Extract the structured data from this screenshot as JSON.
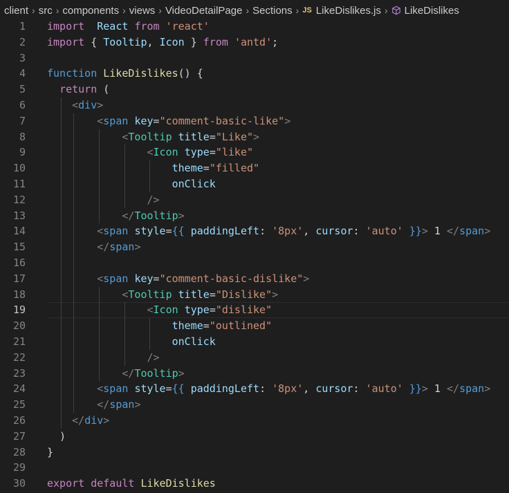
{
  "breadcrumb": {
    "items": [
      "client",
      "src",
      "components",
      "views",
      "VideoDetailPage",
      "Sections"
    ],
    "file_badge": "JS",
    "file": "LikeDislikes.js",
    "symbol": "LikeDislikes"
  },
  "editor": {
    "current_line": 19,
    "lines": [
      {
        "n": "1",
        "s": [
          [
            "kw",
            "import"
          ],
          [
            "",
            "  "
          ],
          [
            "var",
            "React"
          ],
          [
            "",
            " "
          ],
          [
            "kw",
            "from"
          ],
          [
            "",
            " "
          ],
          [
            "str",
            "'react'"
          ]
        ]
      },
      {
        "n": "2",
        "s": [
          [
            "kw",
            "import"
          ],
          [
            "",
            " { "
          ],
          [
            "var",
            "Tooltip"
          ],
          [
            "",
            ", "
          ],
          [
            "var",
            "Icon"
          ],
          [
            "",
            " } "
          ],
          [
            "kw",
            "from"
          ],
          [
            "",
            " "
          ],
          [
            "str",
            "'antd'"
          ],
          [
            "",
            ";"
          ]
        ]
      },
      {
        "n": "3",
        "s": []
      },
      {
        "n": "4",
        "s": [
          [
            "kwb",
            "function"
          ],
          [
            "",
            " "
          ],
          [
            "fn",
            "LikeDislikes"
          ],
          [
            "",
            "() {"
          ]
        ]
      },
      {
        "n": "5",
        "s": [
          [
            "",
            "  "
          ],
          [
            "kw",
            "return"
          ],
          [
            "",
            " ("
          ]
        ]
      },
      {
        "n": "6",
        "s": [
          [
            "",
            "    "
          ],
          [
            "br",
            "<"
          ],
          [
            "htag",
            "div"
          ],
          [
            "br",
            ">"
          ]
        ]
      },
      {
        "n": "7",
        "s": [
          [
            "",
            "        "
          ],
          [
            "br",
            "<"
          ],
          [
            "htag",
            "span"
          ],
          [
            "",
            " "
          ],
          [
            "attr",
            "key"
          ],
          [
            "",
            "="
          ],
          [
            "str",
            "\"comment-basic-like\""
          ],
          [
            "br",
            ">"
          ]
        ]
      },
      {
        "n": "8",
        "s": [
          [
            "",
            "            "
          ],
          [
            "br",
            "<"
          ],
          [
            "tag",
            "Tooltip"
          ],
          [
            "",
            " "
          ],
          [
            "attr",
            "title"
          ],
          [
            "",
            "="
          ],
          [
            "str",
            "\"Like\""
          ],
          [
            "br",
            ">"
          ]
        ]
      },
      {
        "n": "9",
        "s": [
          [
            "",
            "                "
          ],
          [
            "br",
            "<"
          ],
          [
            "tag",
            "Icon"
          ],
          [
            "",
            " "
          ],
          [
            "attr",
            "type"
          ],
          [
            "",
            "="
          ],
          [
            "str",
            "\"like\""
          ]
        ]
      },
      {
        "n": "10",
        "s": [
          [
            "",
            "                    "
          ],
          [
            "attr",
            "theme"
          ],
          [
            "",
            "="
          ],
          [
            "str",
            "\"filled\""
          ]
        ]
      },
      {
        "n": "11",
        "s": [
          [
            "",
            "                    "
          ],
          [
            "attr",
            "onClick"
          ]
        ]
      },
      {
        "n": "12",
        "s": [
          [
            "",
            "                "
          ],
          [
            "br",
            "/>"
          ]
        ]
      },
      {
        "n": "13",
        "s": [
          [
            "",
            "            "
          ],
          [
            "br",
            "</"
          ],
          [
            "tag",
            "Tooltip"
          ],
          [
            "br",
            ">"
          ]
        ]
      },
      {
        "n": "14",
        "s": [
          [
            "",
            "        "
          ],
          [
            "br",
            "<"
          ],
          [
            "htag",
            "span"
          ],
          [
            "",
            " "
          ],
          [
            "attr",
            "style"
          ],
          [
            "",
            "="
          ],
          [
            "kwb",
            "{{"
          ],
          [
            "",
            " "
          ],
          [
            "var",
            "paddingLeft"
          ],
          [
            "",
            ": "
          ],
          [
            "str",
            "'8px'"
          ],
          [
            "",
            ", "
          ],
          [
            "var",
            "cursor"
          ],
          [
            "",
            ": "
          ],
          [
            "str",
            "'auto'"
          ],
          [
            "",
            " "
          ],
          [
            "kwb",
            "}}"
          ],
          [
            "br",
            ">"
          ],
          [
            "",
            " 1 "
          ],
          [
            "br",
            "</"
          ],
          [
            "htag",
            "span"
          ],
          [
            "br",
            ">"
          ]
        ]
      },
      {
        "n": "15",
        "s": [
          [
            "",
            "        "
          ],
          [
            "br",
            "</"
          ],
          [
            "htag",
            "span"
          ],
          [
            "br",
            ">"
          ]
        ]
      },
      {
        "n": "16",
        "s": []
      },
      {
        "n": "17",
        "s": [
          [
            "",
            "        "
          ],
          [
            "br",
            "<"
          ],
          [
            "htag",
            "span"
          ],
          [
            "",
            " "
          ],
          [
            "attr",
            "key"
          ],
          [
            "",
            "="
          ],
          [
            "str",
            "\"comment-basic-dislike\""
          ],
          [
            "br",
            ">"
          ]
        ]
      },
      {
        "n": "18",
        "s": [
          [
            "",
            "            "
          ],
          [
            "br",
            "<"
          ],
          [
            "tag",
            "Tooltip"
          ],
          [
            "",
            " "
          ],
          [
            "attr",
            "title"
          ],
          [
            "",
            "="
          ],
          [
            "str",
            "\"Dislike\""
          ],
          [
            "br",
            ">"
          ]
        ]
      },
      {
        "n": "19",
        "s": [
          [
            "",
            "                "
          ],
          [
            "br",
            "<"
          ],
          [
            "tag",
            "Icon"
          ],
          [
            "",
            " "
          ],
          [
            "attr",
            "type"
          ],
          [
            "",
            "="
          ],
          [
            "str",
            "\"dislike\""
          ]
        ]
      },
      {
        "n": "20",
        "s": [
          [
            "",
            "                    "
          ],
          [
            "attr",
            "theme"
          ],
          [
            "",
            "="
          ],
          [
            "str",
            "\"outlined\""
          ]
        ]
      },
      {
        "n": "21",
        "s": [
          [
            "",
            "                    "
          ],
          [
            "attr",
            "onClick"
          ]
        ]
      },
      {
        "n": "22",
        "s": [
          [
            "",
            "                "
          ],
          [
            "br",
            "/>"
          ]
        ]
      },
      {
        "n": "23",
        "s": [
          [
            "",
            "            "
          ],
          [
            "br",
            "</"
          ],
          [
            "tag",
            "Tooltip"
          ],
          [
            "br",
            ">"
          ]
        ]
      },
      {
        "n": "24",
        "s": [
          [
            "",
            "        "
          ],
          [
            "br",
            "<"
          ],
          [
            "htag",
            "span"
          ],
          [
            "",
            " "
          ],
          [
            "attr",
            "style"
          ],
          [
            "",
            "="
          ],
          [
            "kwb",
            "{{"
          ],
          [
            "",
            " "
          ],
          [
            "var",
            "paddingLeft"
          ],
          [
            "",
            ": "
          ],
          [
            "str",
            "'8px'"
          ],
          [
            "",
            ", "
          ],
          [
            "var",
            "cursor"
          ],
          [
            "",
            ": "
          ],
          [
            "str",
            "'auto'"
          ],
          [
            "",
            " "
          ],
          [
            "kwb",
            "}}"
          ],
          [
            "br",
            ">"
          ],
          [
            "",
            " 1 "
          ],
          [
            "br",
            "</"
          ],
          [
            "htag",
            "span"
          ],
          [
            "br",
            ">"
          ]
        ]
      },
      {
        "n": "25",
        "s": [
          [
            "",
            "        "
          ],
          [
            "br",
            "</"
          ],
          [
            "htag",
            "span"
          ],
          [
            "br",
            ">"
          ]
        ]
      },
      {
        "n": "26",
        "s": [
          [
            "",
            "    "
          ],
          [
            "br",
            "</"
          ],
          [
            "htag",
            "div"
          ],
          [
            "br",
            ">"
          ]
        ]
      },
      {
        "n": "27",
        "s": [
          [
            "",
            "  )"
          ]
        ]
      },
      {
        "n": "28",
        "s": [
          [
            "",
            "}"
          ]
        ]
      },
      {
        "n": "29",
        "s": []
      },
      {
        "n": "30",
        "s": [
          [
            "kw",
            "export"
          ],
          [
            "",
            " "
          ],
          [
            "kw",
            "default"
          ],
          [
            "",
            " "
          ],
          [
            "def",
            "LikeDislikes"
          ]
        ]
      }
    ]
  }
}
